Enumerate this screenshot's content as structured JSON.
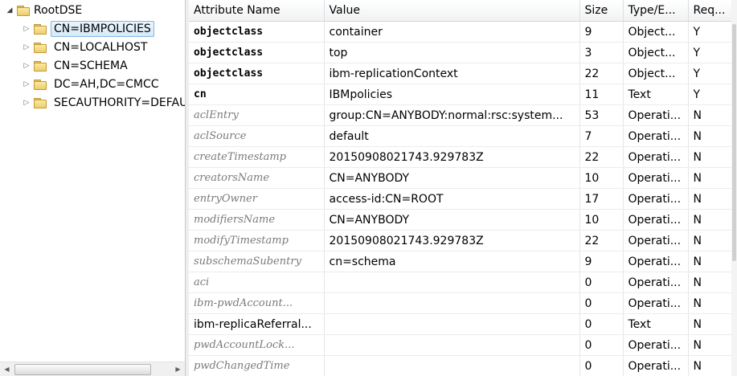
{
  "tree": {
    "root_label": "RootDSE",
    "items": [
      {
        "label": "CN=IBMPOLICIES",
        "selected": true
      },
      {
        "label": "CN=LOCALHOST",
        "selected": false
      },
      {
        "label": "CN=SCHEMA",
        "selected": false
      },
      {
        "label": "DC=AH,DC=CMCC",
        "selected": false
      },
      {
        "label": "SECAUTHORITY=DEFAULT",
        "selected": false
      }
    ]
  },
  "grid": {
    "columns": [
      "Attribute Name",
      "Value",
      "Size",
      "Type/E...",
      "Req..."
    ],
    "rows": [
      {
        "name": "objectclass",
        "style": "bold",
        "value": "container",
        "size": "9",
        "type": "Object...",
        "req": "Y"
      },
      {
        "name": "objectclass",
        "style": "bold",
        "value": "top",
        "size": "3",
        "type": "Object...",
        "req": "Y"
      },
      {
        "name": "objectclass",
        "style": "bold",
        "value": "ibm-replicationContext",
        "size": "22",
        "type": "Object...",
        "req": "Y"
      },
      {
        "name": "cn",
        "style": "bold",
        "value": "IBMpolicies",
        "size": "11",
        "type": "Text",
        "req": "Y"
      },
      {
        "name": "aclEntry",
        "style": "operational",
        "value": "group:CN=ANYBODY:normal:rsc:system...",
        "size": "53",
        "type": "Operati...",
        "req": "N"
      },
      {
        "name": "aclSource",
        "style": "operational",
        "value": "default",
        "size": "7",
        "type": "Operati...",
        "req": "N"
      },
      {
        "name": "createTimestamp",
        "style": "operational",
        "value": "20150908021743.929783Z",
        "size": "22",
        "type": "Operati...",
        "req": "N"
      },
      {
        "name": "creatorsName",
        "style": "operational",
        "value": "CN=ANYBODY",
        "size": "10",
        "type": "Operati...",
        "req": "N"
      },
      {
        "name": "entryOwner",
        "style": "operational",
        "value": "access-id:CN=ROOT",
        "size": "17",
        "type": "Operati...",
        "req": "N"
      },
      {
        "name": "modifiersName",
        "style": "operational",
        "value": "CN=ANYBODY",
        "size": "10",
        "type": "Operati...",
        "req": "N"
      },
      {
        "name": "modifyTimestamp",
        "style": "operational",
        "value": "20150908021743.929783Z",
        "size": "22",
        "type": "Operati...",
        "req": "N"
      },
      {
        "name": "subschemaSubentry",
        "style": "operational",
        "value": "cn=schema",
        "size": "9",
        "type": "Operati...",
        "req": "N"
      },
      {
        "name": "aci",
        "style": "operational",
        "value": "",
        "size": "0",
        "type": "Operati...",
        "req": "N"
      },
      {
        "name": "ibm-pwdAccount...",
        "style": "operational",
        "value": "",
        "size": "0",
        "type": "Operati...",
        "req": "N"
      },
      {
        "name": "ibm-replicaReferral...",
        "style": "plain",
        "value": "",
        "size": "0",
        "type": "Text",
        "req": "N"
      },
      {
        "name": "pwdAccountLock...",
        "style": "operational",
        "value": "",
        "size": "0",
        "type": "Operati...",
        "req": "N"
      },
      {
        "name": "pwdChangedTime",
        "style": "operational",
        "value": "",
        "size": "0",
        "type": "Operati...",
        "req": "N"
      }
    ]
  }
}
